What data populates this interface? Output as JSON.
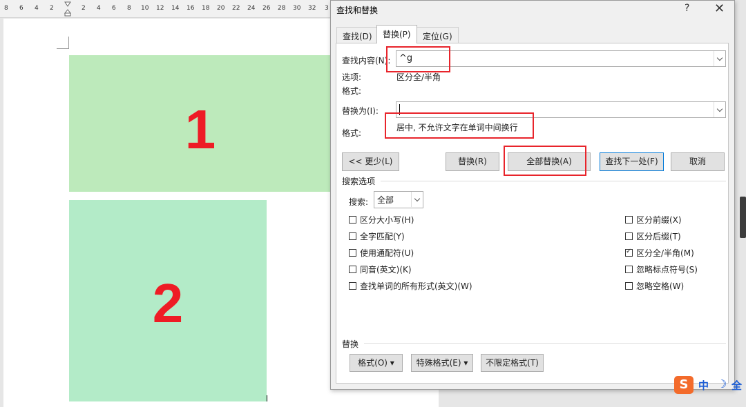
{
  "ruler": {
    "ticks": [
      "8",
      "6",
      "4",
      "2",
      "2",
      "4",
      "6",
      "8",
      "10",
      "12",
      "14",
      "16",
      "18",
      "20",
      "22",
      "24",
      "26",
      "28",
      "30",
      "32",
      "3"
    ]
  },
  "document": {
    "box1_label": "1",
    "box2_label": "2"
  },
  "dialog": {
    "title": "查找和替换",
    "help": "?",
    "close": "✕",
    "tabs": [
      {
        "label": "查找(D)",
        "active": false
      },
      {
        "label": "替换(P)",
        "active": true
      },
      {
        "label": "定位(G)",
        "active": false
      }
    ],
    "find": {
      "label": "查找内容(N):",
      "value": "^g",
      "options_label": "选项:",
      "options_value": "区分全/半角",
      "format_label": "格式:"
    },
    "replace": {
      "label": "替换为(I):",
      "value": "",
      "format_label": "格式:",
      "format_value": "居中, 不允许文字在单词中间换行"
    },
    "buttons": {
      "less": "<< 更少(L)",
      "replace": "替换(R)",
      "replace_all": "全部替换(A)",
      "find_next": "查找下一处(F)",
      "cancel": "取消"
    },
    "search_options": {
      "section_label": "搜索选项",
      "search_label": "搜索:",
      "search_value": "全部",
      "left_checks": [
        {
          "label": "区分大小写(H)",
          "checked": false
        },
        {
          "label": "全字匹配(Y)",
          "checked": false
        },
        {
          "label": "使用通配符(U)",
          "checked": false
        },
        {
          "label": "同音(英文)(K)",
          "checked": false
        },
        {
          "label": "查找单词的所有形式(英文)(W)",
          "checked": false
        }
      ],
      "right_checks": [
        {
          "label": "区分前缀(X)",
          "checked": false
        },
        {
          "label": "区分后缀(T)",
          "checked": false
        },
        {
          "label": "区分全/半角(M)",
          "checked": true
        },
        {
          "label": "忽略标点符号(S)",
          "checked": false
        },
        {
          "label": "忽略空格(W)",
          "checked": false
        }
      ]
    },
    "replace_section": {
      "label": "替换",
      "format_btn": "格式(O)",
      "special_btn": "特殊格式(E)",
      "no_format_btn": "不限定格式(T)"
    }
  },
  "ime": {
    "logo": "S",
    "mode": "中",
    "moon": "☽",
    "width": "全"
  },
  "colors": {
    "box1": "#bdeabb",
    "box2": "#b3ebc8",
    "number_red": "#ee1c25",
    "highlight_red": "#e8242b",
    "ime_orange": "#f36b2b"
  }
}
